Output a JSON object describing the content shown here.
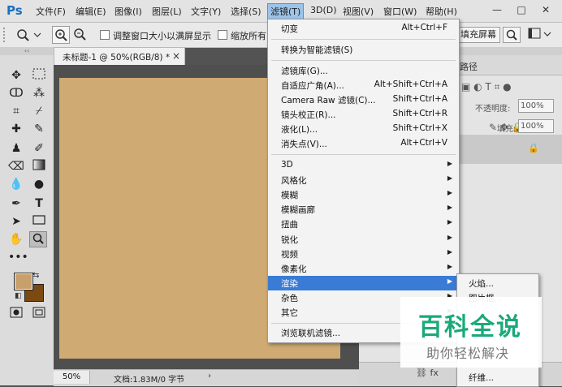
{
  "app": {
    "logo": "Ps"
  },
  "menubar": {
    "items": [
      "文件(F)",
      "编辑(E)",
      "图像(I)",
      "图层(L)",
      "文字(Y)",
      "选择(S)",
      "滤镜(T)",
      "3D(D)",
      "视图(V)",
      "窗口(W)",
      "帮助(H)"
    ],
    "window_controls": [
      "—",
      "□",
      "✕"
    ]
  },
  "options": {
    "resize_window_label": "调整窗口大小以满屏显示",
    "zoom_all_label": "缩放所有",
    "fill_screen_label": "填充屏幕"
  },
  "document": {
    "tab_title": "未标题-1 @ 50%(RGB/8) *",
    "tab_close": "×",
    "canvas_color": "#d0aa73",
    "zoom": "50%",
    "doc_info": "文档:1.83M/0 字节"
  },
  "tools": {
    "foreground_color": "#c8a06b",
    "background_color": "#7a4a12"
  },
  "right_panel": {
    "tab_partial": "路径",
    "opacity_label": "不透明度:",
    "opacity_value": "100%",
    "fill_label": "填充:",
    "fill_value": "100%",
    "bottom_partial": "纤维..."
  },
  "filter_menu": {
    "top_items": [
      {
        "label": "切变",
        "shortcut": "Alt+Ctrl+F"
      },
      {
        "label": "转换为智能滤镜(S)",
        "shortcut": ""
      }
    ],
    "mid_items": [
      {
        "label": "滤镜库(G)...",
        "shortcut": ""
      },
      {
        "label": "自适应广角(A)...",
        "shortcut": "Alt+Shift+Ctrl+A"
      },
      {
        "label": "Camera Raw 滤镜(C)...",
        "shortcut": "Shift+Ctrl+A"
      },
      {
        "label": "镜头校正(R)...",
        "shortcut": "Shift+Ctrl+R"
      },
      {
        "label": "液化(L)...",
        "shortcut": "Shift+Ctrl+X"
      },
      {
        "label": "消失点(V)...",
        "shortcut": "Alt+Ctrl+V"
      }
    ],
    "sub_items": [
      "3D",
      "风格化",
      "模糊",
      "模糊画廊",
      "扭曲",
      "锐化",
      "视频",
      "像素化",
      "渲染",
      "杂色",
      "其它"
    ],
    "highlighted": "渲染",
    "bottom_item": "浏览联机滤镜..."
  },
  "render_submenu": {
    "items": [
      "火焰...",
      "图片框..."
    ]
  },
  "watermark": {
    "title": "百科全说",
    "subtitle": "助你轻松解决"
  }
}
